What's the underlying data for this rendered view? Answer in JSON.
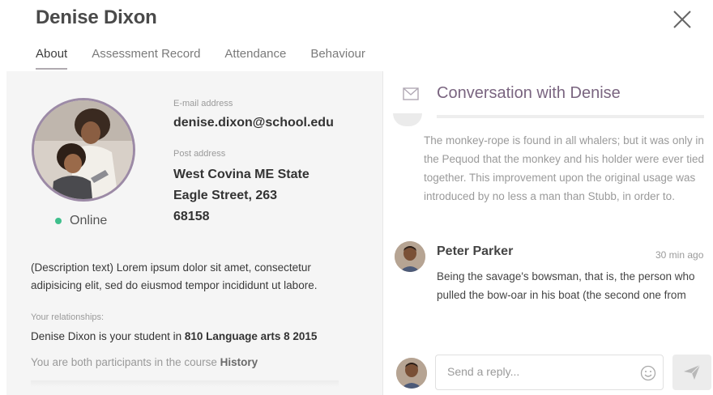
{
  "header": {
    "title": "Denise Dixon",
    "tabs": [
      {
        "label": "About"
      },
      {
        "label": "Assessment Record"
      },
      {
        "label": "Attendance"
      },
      {
        "label": "Behaviour"
      }
    ],
    "active_tab": "About",
    "close_icon": "close-icon"
  },
  "profile": {
    "status": "Online",
    "status_color": "#3fbf8c",
    "email_label": "E-mail address",
    "email": "denise.dixon@school.edu",
    "post_label": "Post address",
    "address_line1": "West Covina ME State",
    "address_line2": "Eagle Street, 263",
    "address_line3": "68158",
    "description": "(Description text) Lorem ipsum dolor sit amet, consectetur adipisicing elit, sed do eiusmod tempor incididunt ut labore.",
    "relationships_label": "Your relationships:",
    "relationship1_prefix": "Denise Dixon is your student in ",
    "relationship1_course": "810 Language arts 8 2015",
    "relationship2_prefix": "You are both participants in the course ",
    "relationship2_course": "History"
  },
  "conversation": {
    "title": "Conversation with Denise",
    "icon": "envelope-icon",
    "faded_message": "The monkey-rope is found in all whalers; but it was only in the Pequod that the monkey and his holder were ever tied together. This improvement upon the original usage was introduced by no less a man than Stubb, in order to.",
    "messages": [
      {
        "sender": "Peter Parker",
        "time": "30 min ago",
        "text": "Being the savage's bowsman, that is, the person who pulled the bow-oar in his boat (the second one from"
      }
    ],
    "reply_placeholder": "Send a reply...",
    "emoji_icon": "smiley-icon",
    "send_icon": "send-icon"
  },
  "colors": {
    "accent": "#7a6580",
    "avatar_ring": "#9c8aa6"
  }
}
